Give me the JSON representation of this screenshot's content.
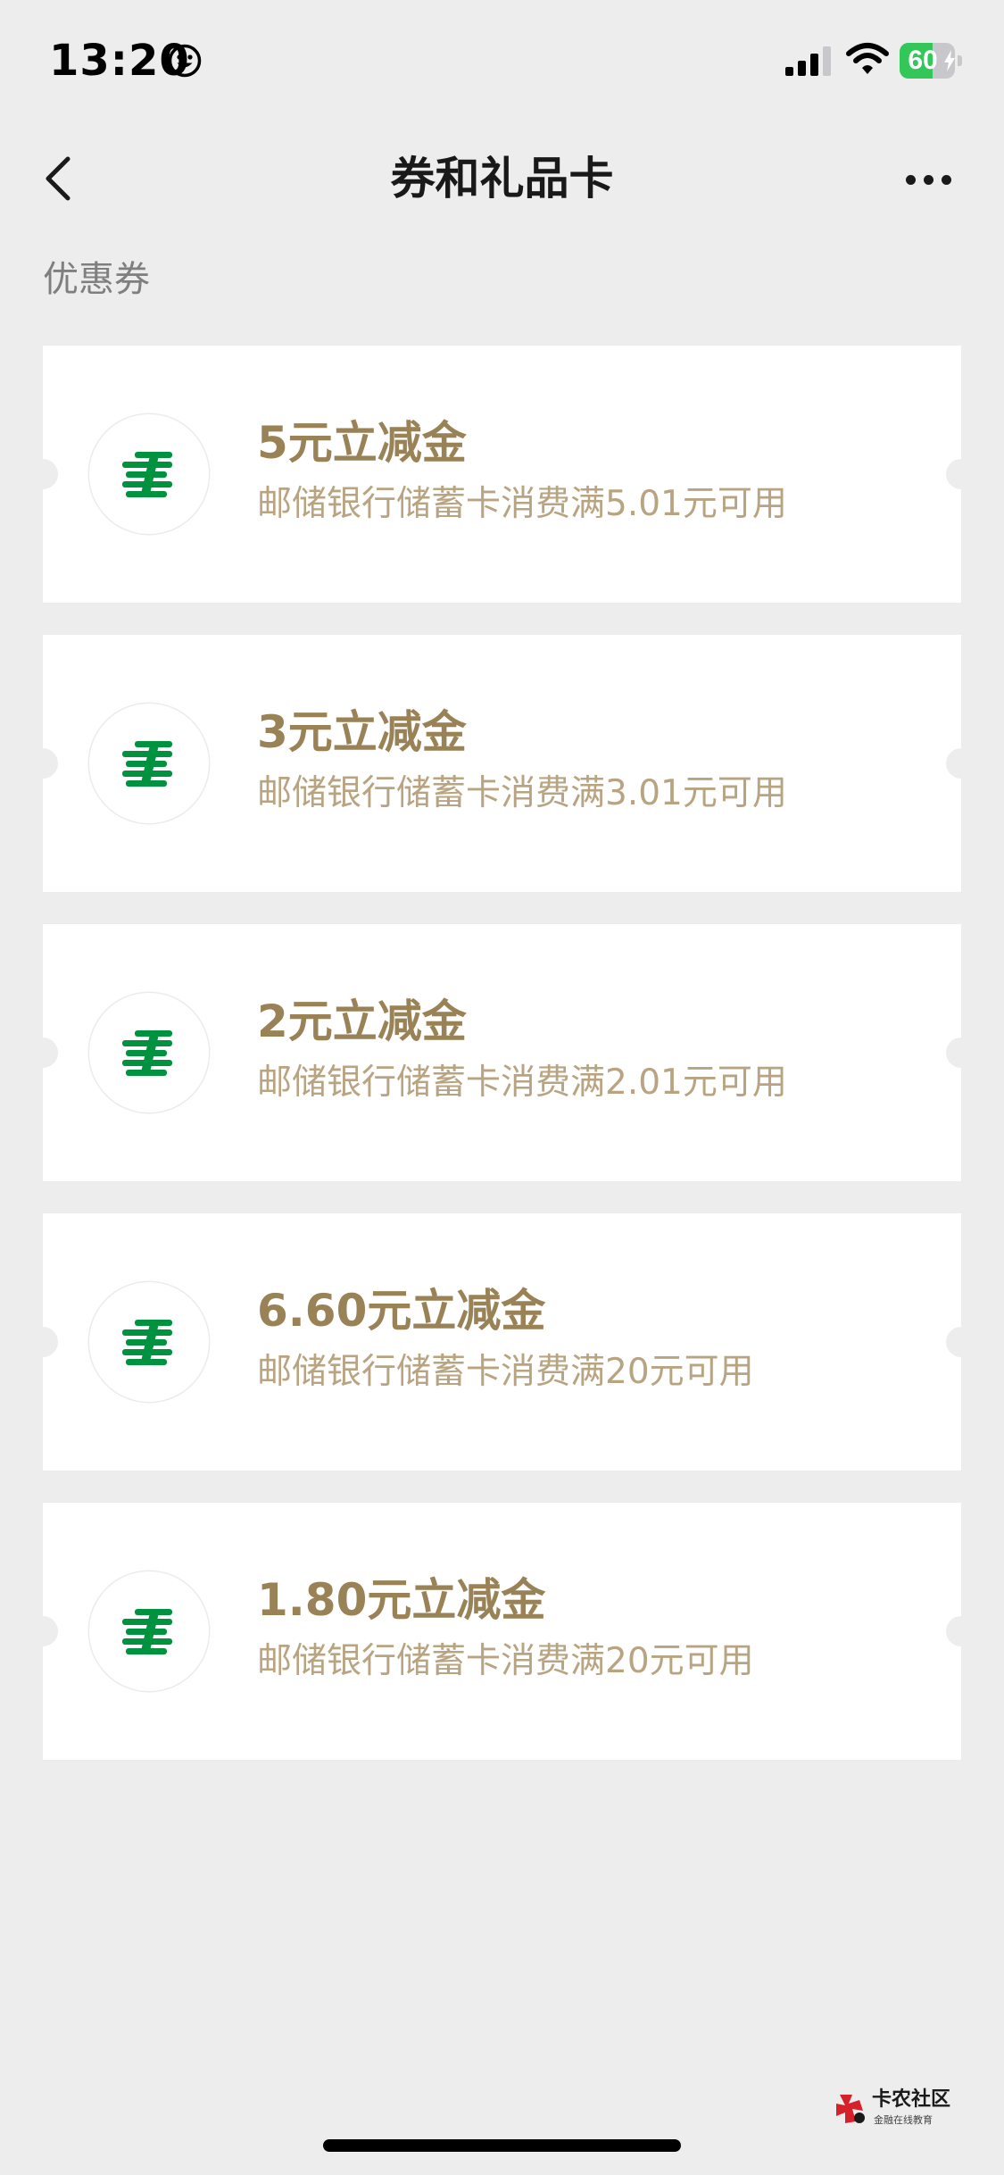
{
  "status_bar": {
    "time": "13:20",
    "battery_level": "60",
    "battery_percent": 60,
    "signal_bars": 3,
    "icons": [
      "smiley-icon",
      "signal-icon",
      "wifi-icon",
      "battery-icon",
      "bolt-icon"
    ]
  },
  "nav": {
    "title": "券和礼品卡",
    "back_icon": "chevron-left-icon",
    "more_icon": "more-dots-icon"
  },
  "section": {
    "label": "优惠券"
  },
  "coupons": [
    {
      "title": "5元立减金",
      "desc": "邮储银行储蓄卡消费满5.01元可用",
      "logo": "postal-bank-logo"
    },
    {
      "title": "3元立减金",
      "desc": "邮储银行储蓄卡消费满3.01元可用",
      "logo": "postal-bank-logo"
    },
    {
      "title": "2元立减金",
      "desc": "邮储银行储蓄卡消费满2.01元可用",
      "logo": "postal-bank-logo"
    },
    {
      "title": "6.60元立减金",
      "desc": "邮储银行储蓄卡消费满20元可用",
      "logo": "postal-bank-logo"
    },
    {
      "title": "1.80元立减金",
      "desc": "邮储银行储蓄卡消费满20元可用",
      "logo": "postal-bank-logo"
    }
  ],
  "watermark": {
    "name": "卡农社区",
    "sub": "金融在线教育"
  },
  "colors": {
    "background": "#ededed",
    "card": "#ffffff",
    "coupon_title": "#9a8257",
    "coupon_desc": "#b9a482",
    "postal_green": "#00923f",
    "battery_green": "#33c759"
  }
}
